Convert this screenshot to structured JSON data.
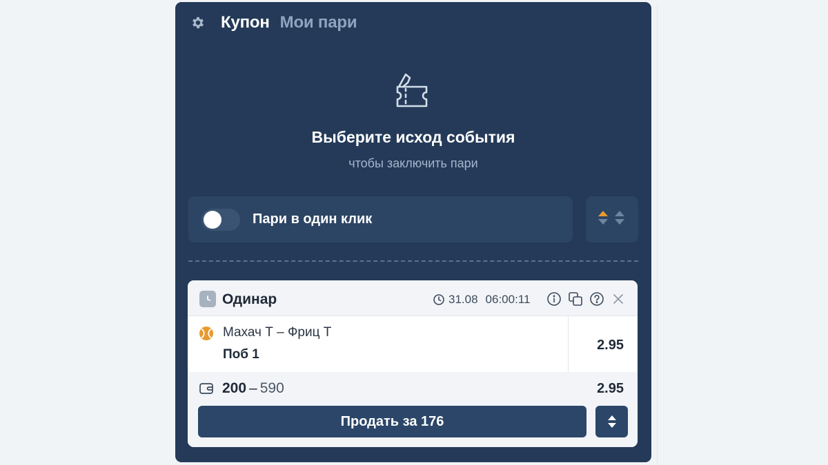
{
  "coupon": {
    "tabs": [
      {
        "label": "Купон",
        "active": true
      },
      {
        "label": "Мои пари",
        "active": false
      }
    ],
    "empty": {
      "title": "Выберите исход события",
      "subtitle": "чтобы заключить пари"
    },
    "one_click": {
      "label": "Пари в один клик",
      "enabled": false
    }
  },
  "bet": {
    "type_label": "Одинар",
    "date": "31.08",
    "time": "06:00:11",
    "event": {
      "teams": "Махач Т – Фриц Т",
      "outcome": "Поб 1",
      "odds": "2.95"
    },
    "stake": "200",
    "stake_sep": "–",
    "potential_win": "590",
    "total_odds": "2.95",
    "sell_label": "Продать за 176"
  },
  "icons": {
    "settings": "gear-icon",
    "empty_state": "ticket-icon",
    "sort": "sort-arrows-icon",
    "bet_type": "clock-icon",
    "datetime": "clock-outline-icon",
    "info": "info-icon",
    "copy": "copy-icon",
    "help": "help-icon",
    "close": "close-icon",
    "sport": "tennis-ball-icon",
    "wallet": "wallet-icon",
    "sell_options": "up-down-arrows-icon"
  },
  "colors": {
    "panel_bg": "#243a58",
    "accent_orange": "#e79a2e",
    "button_bg": "#2b4668"
  }
}
